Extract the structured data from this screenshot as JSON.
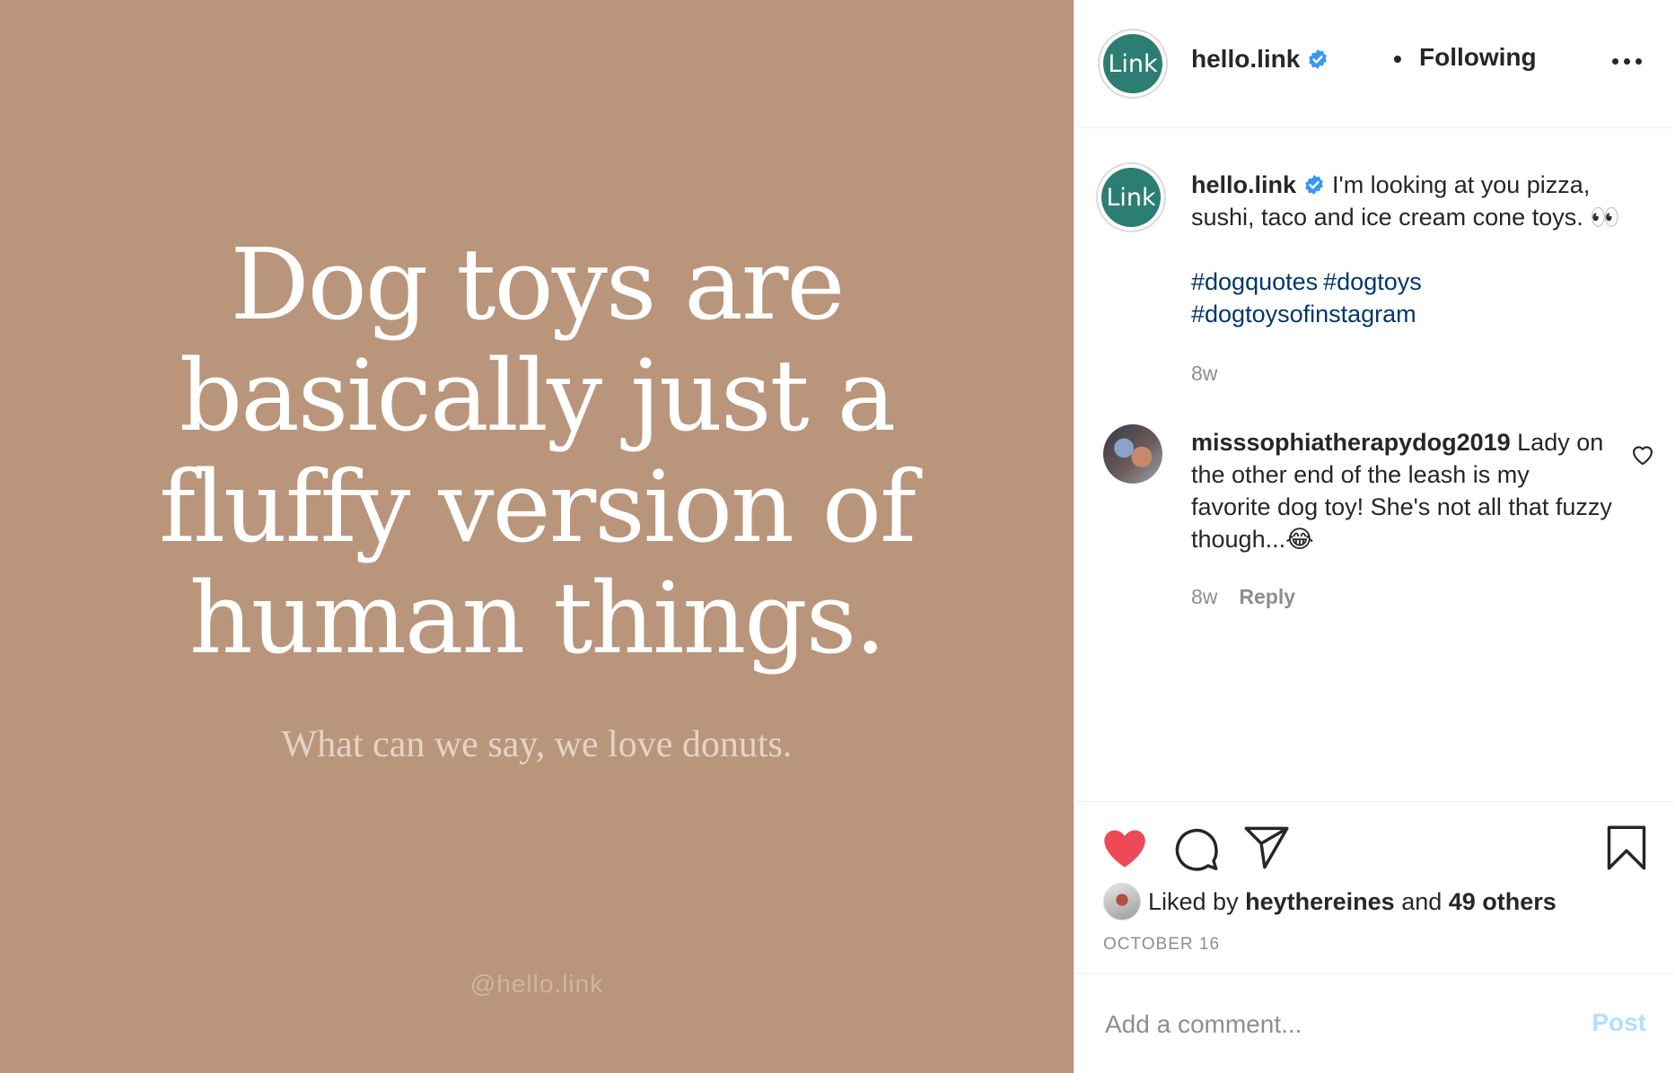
{
  "image": {
    "quote_lines": [
      "Dog toys are",
      "basically just a",
      "fluffy version of",
      "human things."
    ],
    "subline": "What can we say, we love donuts.",
    "watermark": "@hello.link",
    "background_color": "#b9957b"
  },
  "header": {
    "avatar_text": "Link",
    "username": "hello.link",
    "separator": "•",
    "follow_state": "Following",
    "more_icon": "more-horizontal-icon"
  },
  "caption": {
    "avatar_text": "Link",
    "username": "hello.link",
    "text": "I'm looking at you pizza, sushi, taco and ice cream cone toys. 👀",
    "hashtags": [
      "#dogquotes",
      "#dogtoys",
      "#dogtoysofinstagram"
    ],
    "time": "8w"
  },
  "comment": {
    "username": "misssophiatherapydog2019",
    "text": "Lady on the other end of the leash is my favorite dog toy! She's not all that fuzzy though...😂",
    "time": "8w",
    "reply_label": "Reply"
  },
  "actions": {
    "liked_prefix": "Liked by",
    "liked_user": "heythereines",
    "liked_and": "and",
    "liked_others": "49 others",
    "date": "OCTOBER 16",
    "like_color": "#ed4956"
  },
  "add_comment": {
    "placeholder": "Add a comment...",
    "post_label": "Post"
  },
  "colors": {
    "brand_teal": "#2d7e72",
    "verified_blue": "#3897f0",
    "hashtag": "#00376b"
  }
}
